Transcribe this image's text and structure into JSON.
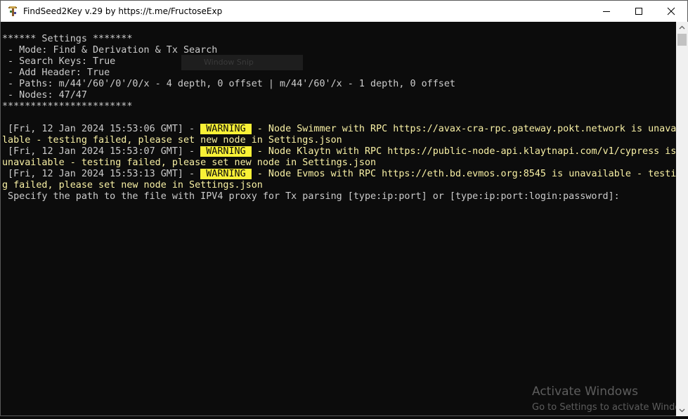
{
  "window": {
    "title": "FindSeed2Key v.29 by https://t.me/FructoseExp",
    "icon": "pickaxe-app-icon"
  },
  "overlay": {
    "snip_label": "Window Snip"
  },
  "console": {
    "settings": [
      "****** Settings *******",
      " - Mode: Find & Derivation & Tx Search",
      " - Search Keys: True",
      " - Add Header: True",
      " - Paths: m/44'/60'/0'/0/x - 4 depth, 0 offset | m/44'/60'/x - 1 depth, 0 offset",
      " - Nodes: 47/47",
      "***********************"
    ],
    "logs": [
      {
        "timestamp": " [Fri, 12 Jan 2024 15:53:06 GMT] - ",
        "level": " WARNING ",
        "message": " - Node Swimmer with RPC https://avax-cra-rpc.gateway.pokt.network is unavai",
        "wrap": "lable - testing failed, please set new node in Settings.json"
      },
      {
        "timestamp": " [Fri, 12 Jan 2024 15:53:07 GMT] - ",
        "level": " WARNING ",
        "message": " - Node Klaytn with RPC https://public-node-api.klaytnapi.com/v1/cypress is",
        "wrap": "unavailable - testing failed, please set new node in Settings.json"
      },
      {
        "timestamp": " [Fri, 12 Jan 2024 15:53:13 GMT] - ",
        "level": " WARNING ",
        "message": " - Node Evmos with RPC https://eth.bd.evmos.org:8545 is unavailable - testin",
        "wrap": "g failed, please set new node in Settings.json"
      }
    ],
    "prompt": " Specify the path to the file with IPV4 proxy for Tx parsing [type:ip:port] or [type:ip:port:login:password]: "
  },
  "watermark": {
    "title": "Activate Windows",
    "subtitle": "Go to Settings to activate Windows."
  },
  "colors": {
    "background": "#0c0c0c",
    "text": "#cccccc",
    "warning_text": "#f9f1a5",
    "warning_badge": "#f9f136"
  }
}
